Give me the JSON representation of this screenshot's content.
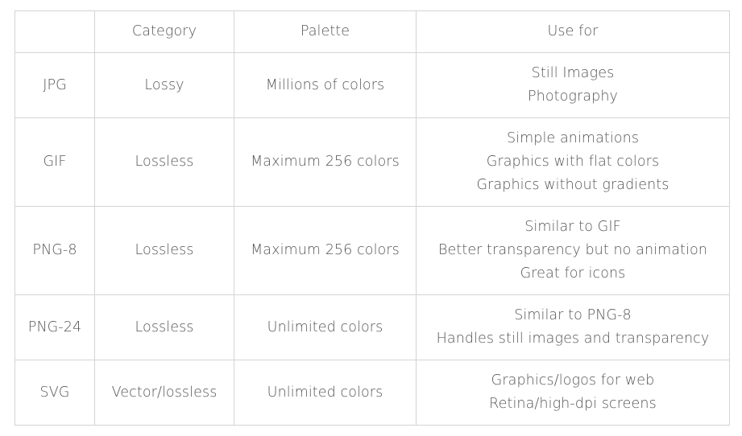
{
  "table": {
    "header": [
      "",
      "Category",
      "Palette",
      "Use for"
    ],
    "rows": [
      {
        "format": "JPG",
        "category": "Lossy",
        "palette": "Millions of colors",
        "use_for": [
          "Still Images",
          "Photography"
        ]
      },
      {
        "format": "GIF",
        "category": "Lossless",
        "palette": "Maximum 256 colors",
        "use_for": [
          "Simple animations",
          "Graphics with flat colors",
          "Graphics without gradients"
        ]
      },
      {
        "format": "PNG-8",
        "category": "Lossless",
        "palette": "Maximum 256 colors",
        "use_for": [
          "Similar to GIF",
          "Better transparency but no animation",
          "Great for icons"
        ]
      },
      {
        "format": "PNG-24",
        "category": "Lossless",
        "palette": "Unlimited colors",
        "use_for": [
          "Similar to PNG-8",
          "Handles still images and transparency"
        ]
      },
      {
        "format": "SVG",
        "category": "Vector/lossless",
        "palette": "Unlimited colors",
        "use_for": [
          "Graphics/logos for web",
          "Retina/high-dpi screens"
        ]
      }
    ]
  }
}
